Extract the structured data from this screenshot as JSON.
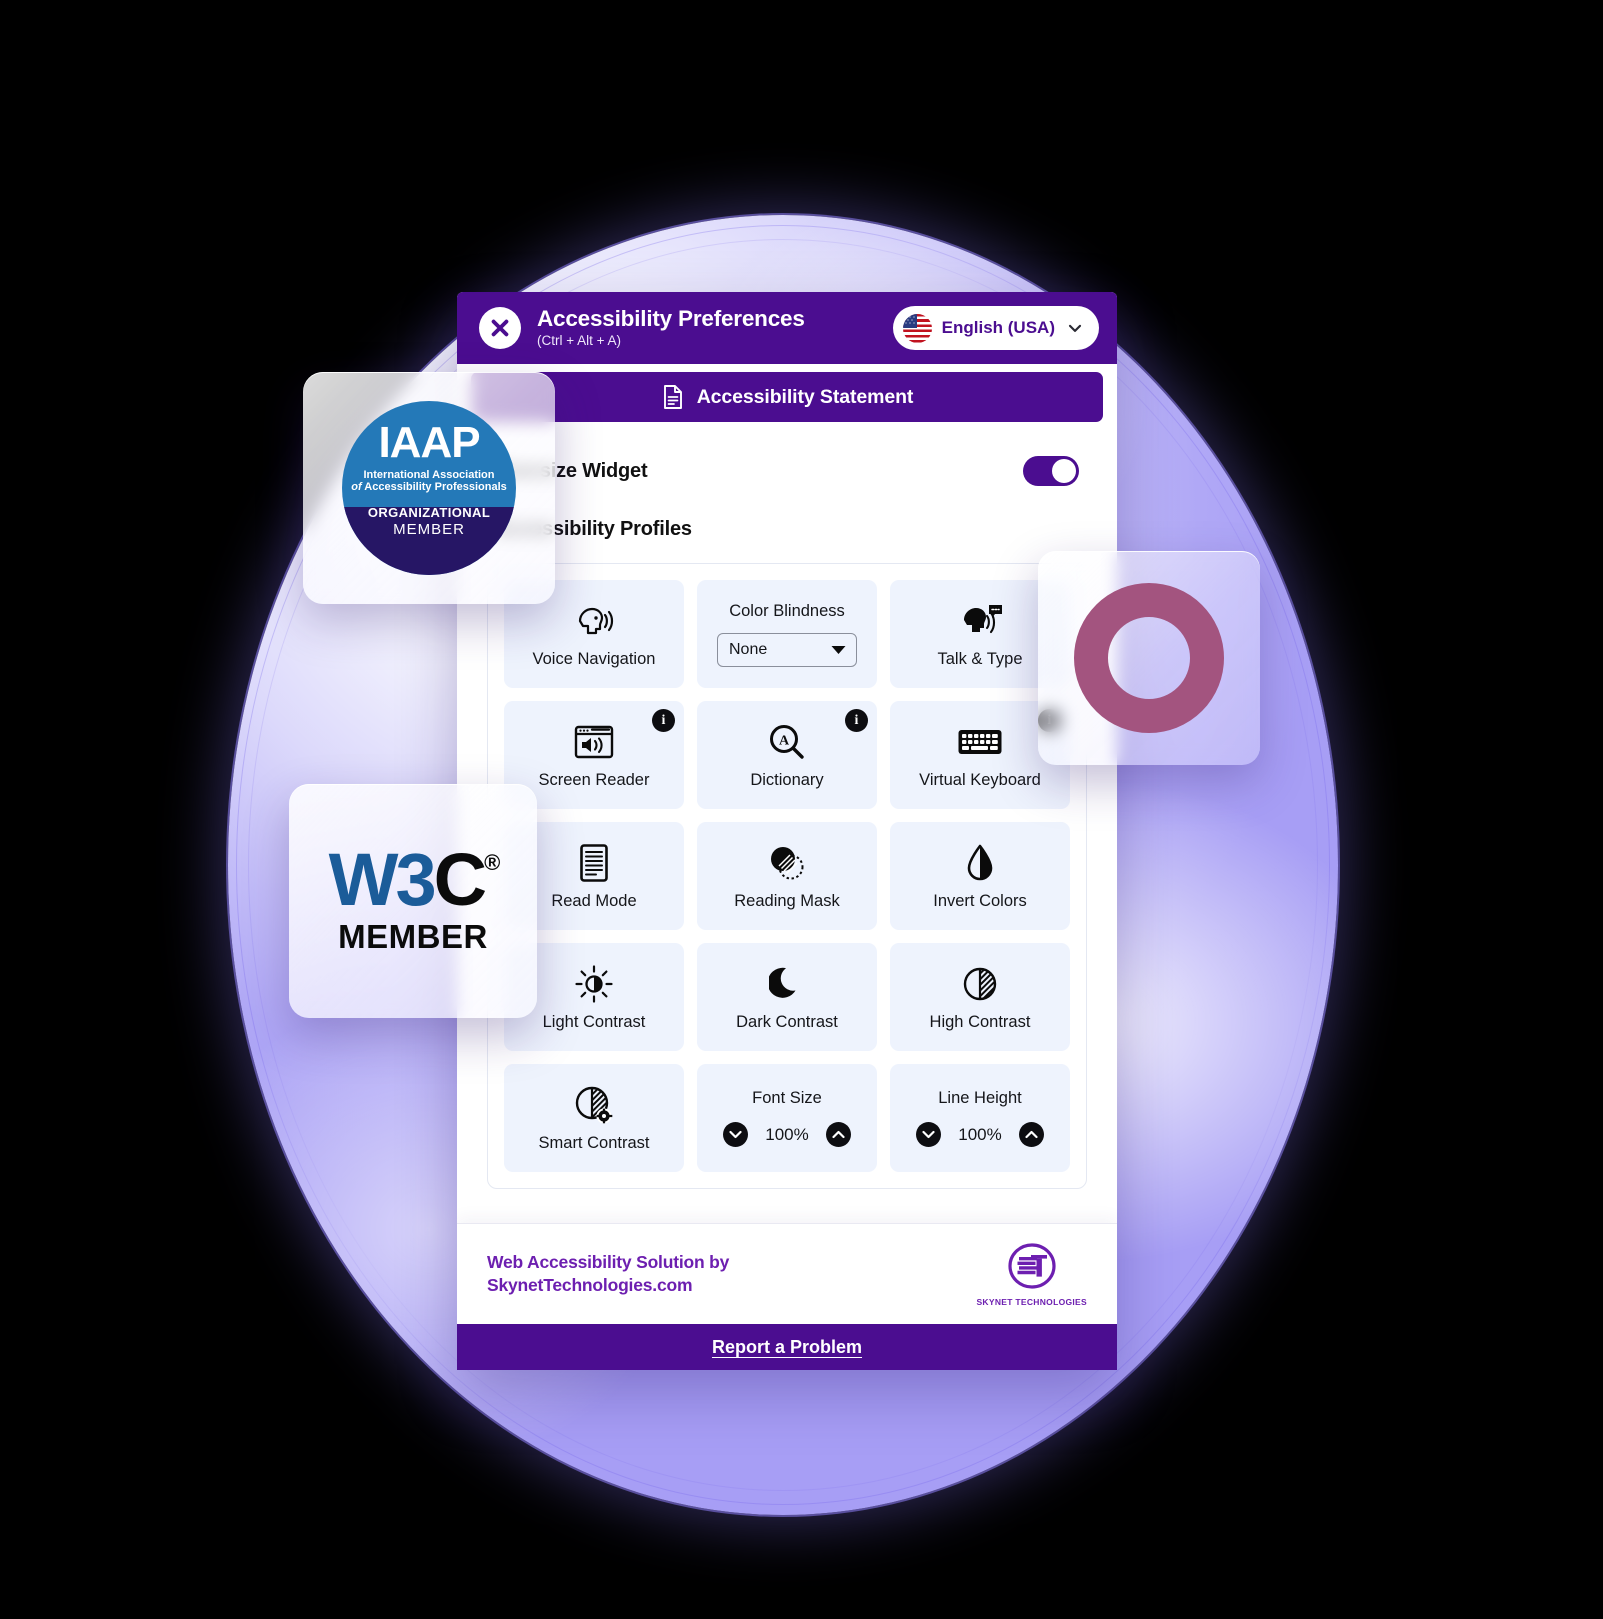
{
  "header": {
    "title": "Accessibility Preferences",
    "shortcut": "(Ctrl + Alt + A)",
    "close_icon": "close-x-icon",
    "language": {
      "label": "English (USA)",
      "flag_icon": "usa-flag-icon",
      "chevron_icon": "chevron-down-icon"
    }
  },
  "statement": {
    "label": "Accessibility Statement",
    "icon": "document-icon"
  },
  "settings": {
    "oversize_widget_label": "Oversize Widget",
    "oversize_widget_on": true,
    "profiles_label": "Accessibility Profiles"
  },
  "grid": {
    "tiles": [
      {
        "label": "Voice Navigation",
        "icon": "voice-navigation-icon",
        "type": "icon",
        "info": false
      },
      {
        "label": "Color Blindness",
        "icon": "color-blindness-select",
        "type": "select",
        "value": "None",
        "info": false
      },
      {
        "label": "Talk & Type",
        "icon": "talk-and-type-icon",
        "type": "icon",
        "info": false
      },
      {
        "label": "Screen Reader",
        "icon": "screen-reader-icon",
        "type": "icon",
        "info": true
      },
      {
        "label": "Dictionary",
        "icon": "dictionary-icon",
        "type": "icon",
        "info": true
      },
      {
        "label": "Virtual Keyboard",
        "icon": "virtual-keyboard-icon",
        "type": "icon",
        "info": true
      },
      {
        "label": "Read Mode",
        "icon": "read-mode-icon",
        "type": "icon",
        "info": false
      },
      {
        "label": "Reading Mask",
        "icon": "reading-mask-icon",
        "type": "icon",
        "info": false
      },
      {
        "label": "Invert Colors",
        "icon": "invert-colors-icon",
        "type": "icon",
        "info": false
      },
      {
        "label": "Light Contrast",
        "icon": "light-contrast-icon",
        "type": "icon",
        "info": false
      },
      {
        "label": "Dark Contrast",
        "icon": "dark-contrast-icon",
        "type": "icon",
        "info": false
      },
      {
        "label": "High Contrast",
        "icon": "high-contrast-icon",
        "type": "icon",
        "info": false
      },
      {
        "label": "Smart Contrast",
        "icon": "smart-contrast-icon",
        "type": "icon",
        "info": false
      },
      {
        "label": "Font Size",
        "icon": "font-size-stepper",
        "type": "stepper",
        "value": "100%",
        "info": false
      },
      {
        "label": "Line Height",
        "icon": "line-height-stepper",
        "type": "stepper",
        "value": "100%",
        "info": false
      }
    ],
    "info_badge_glyph": "i",
    "stepper_down_icon": "chevron-down-icon",
    "stepper_up_icon": "chevron-up-icon"
  },
  "footer": {
    "line1": "Web Accessibility Solution by",
    "line2": "SkynetTechnologies.com",
    "logo_mark": "ST",
    "logo_name": "SKYNET TECHNOLOGIES"
  },
  "report": {
    "label": "Report a Problem"
  },
  "badges": {
    "iaap": {
      "acronym": "IAAP",
      "line1": "International Association",
      "line2_italic": "of",
      "line2": "Accessibility Professionals",
      "tier": "ORGANIZATIONAL",
      "member": "MEMBER"
    },
    "w3c": {
      "mark_blue": "W3",
      "mark_black": "C",
      "registered": "®",
      "member": "MEMBER"
    },
    "ring": {
      "shape": "ring-graphic"
    }
  },
  "colors": {
    "brand_purple": "#4b0d90",
    "footer_purple": "#6d1fb0",
    "tile_bg": "#eef3fd",
    "iaap_blue": "#2479b8",
    "iaap_navy": "#261665",
    "w3c_blue": "#1b5c99",
    "ring_mauve": "#a3547f",
    "halo_violet": "#b0a8f6"
  }
}
